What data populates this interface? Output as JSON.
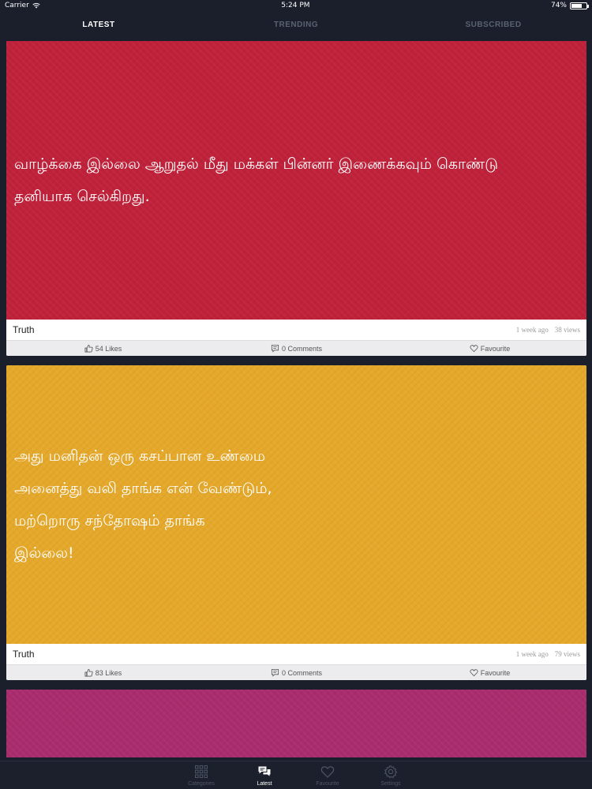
{
  "status_bar": {
    "carrier": "Carrier",
    "time": "5:24 PM",
    "battery": "74%",
    "battery_level": 0.74
  },
  "top_tabs": [
    {
      "label": "LATEST",
      "active": true
    },
    {
      "label": "TRENDING",
      "active": false
    },
    {
      "label": "SUBSCRIBED",
      "active": false
    }
  ],
  "cards": [
    {
      "bg_color": "#c0213a",
      "quote_lines": [
        "வாழ்க்கை இல்லை ஆறுதல் மீது மக்கள் பின்னர் இணைக்கவும் கொண்டு",
        "தனியாக செல்கிறது."
      ],
      "category": "Truth",
      "time_ago": "1 week ago",
      "views": "38 views",
      "likes_label": "54 Likes",
      "comments_label": "0 Comments",
      "favourite_label": "Favourite"
    },
    {
      "bg_color": "#e5a82a",
      "quote_lines": [
        "அது மனிதன் ஒரு கசப்பான உண்மை",
        "அனைத்து வலி தாங்க என் வேண்டும்,",
        "மற்றொரு சந்தோஷம் தாங்க",
        "இல்லை!"
      ],
      "category": "Truth",
      "time_ago": "1 week ago",
      "views": "79 views",
      "likes_label": "83 Likes",
      "comments_label": "0 Comments",
      "favourite_label": "Favourite"
    },
    {
      "bg_color": "#a92c6e"
    }
  ],
  "bottom_nav": [
    {
      "label": "Categories",
      "icon": "grid-icon",
      "active": false
    },
    {
      "label": "Latest",
      "icon": "chat-bubbles-icon",
      "active": true
    },
    {
      "label": "Favourite",
      "icon": "heart-icon",
      "active": false
    },
    {
      "label": "Settings",
      "icon": "gear-icon",
      "active": false
    }
  ]
}
